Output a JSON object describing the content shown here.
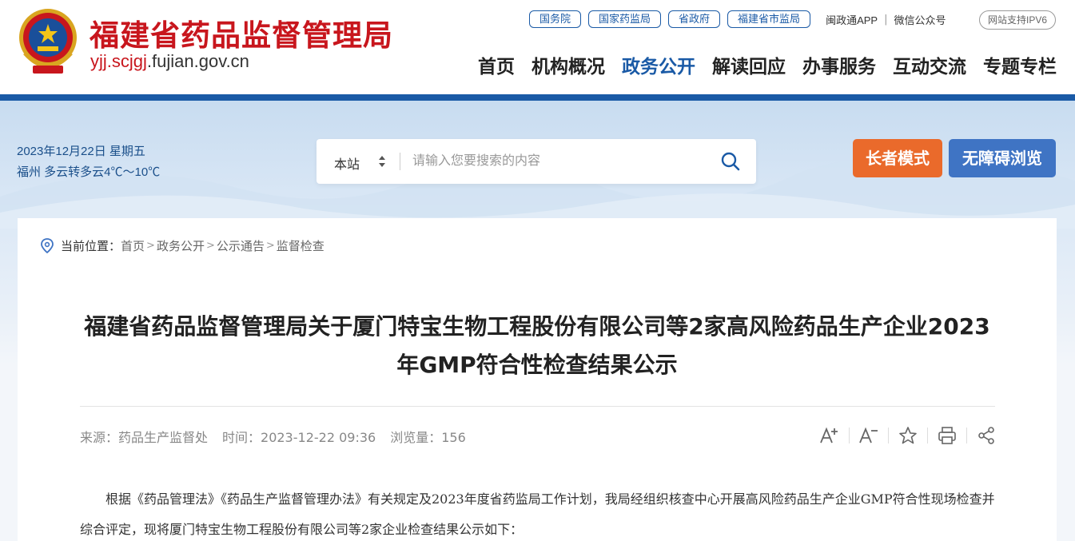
{
  "site": {
    "title": "福建省药品监督管理局",
    "domain_prefix": "yjj.scjgj",
    "domain_suffix": ".fujian.gov.cn",
    "emblem_icon": "national-emblem-icon",
    "brand_color": "#c8161d",
    "accent_color": "#1a5aa6"
  },
  "toplinks": {
    "pills": [
      "国务院",
      "国家药监局",
      "省政府",
      "福建省市监局"
    ],
    "app": "闽政通APP",
    "separator": "|",
    "wechat": "微信公众号",
    "ipv6": "网站支持IPV6"
  },
  "nav": {
    "items": [
      "首页",
      "机构概况",
      "政务公开",
      "解读回应",
      "办事服务",
      "互动交流",
      "专题专栏"
    ],
    "active": "政务公开"
  },
  "banner": {
    "date": "2023年12月22日 星期五",
    "weather": "福州 多云转多云4℃～10℃",
    "search_scope": "本站",
    "search_placeholder": "请输入您要搜索的内容",
    "elder_mode": "长者模式",
    "accessible": "无障碍浏览",
    "elder_color": "#ea6a2b",
    "accessible_color": "#3f74c4"
  },
  "breadcrumb": {
    "label": "当前位置：",
    "items": [
      "首页",
      "政务公开",
      "公示通告",
      "监督检查"
    ],
    "separator": ">"
  },
  "article": {
    "title": "福建省药品监督管理局关于厦门特宝生物工程股份有限公司等2家高风险药品生产企业2023年GMP符合性检查结果公示",
    "source": "来源：药品生产监督处",
    "time": "时间：2023-12-22 09:36",
    "views": "浏览量：156",
    "tools": [
      "font-increase-icon",
      "font-decrease-icon",
      "star-icon",
      "print-icon",
      "share-icon"
    ],
    "body": "根据《药品管理法》《药品生产监督管理办法》有关规定及2023年度省药监局工作计划，我局经组织核查中心开展高风险药品生产企业GMP符合性现场检查并综合评定，现将厦门特宝生物工程股份有限公司等2家企业检查结果公示如下："
  }
}
